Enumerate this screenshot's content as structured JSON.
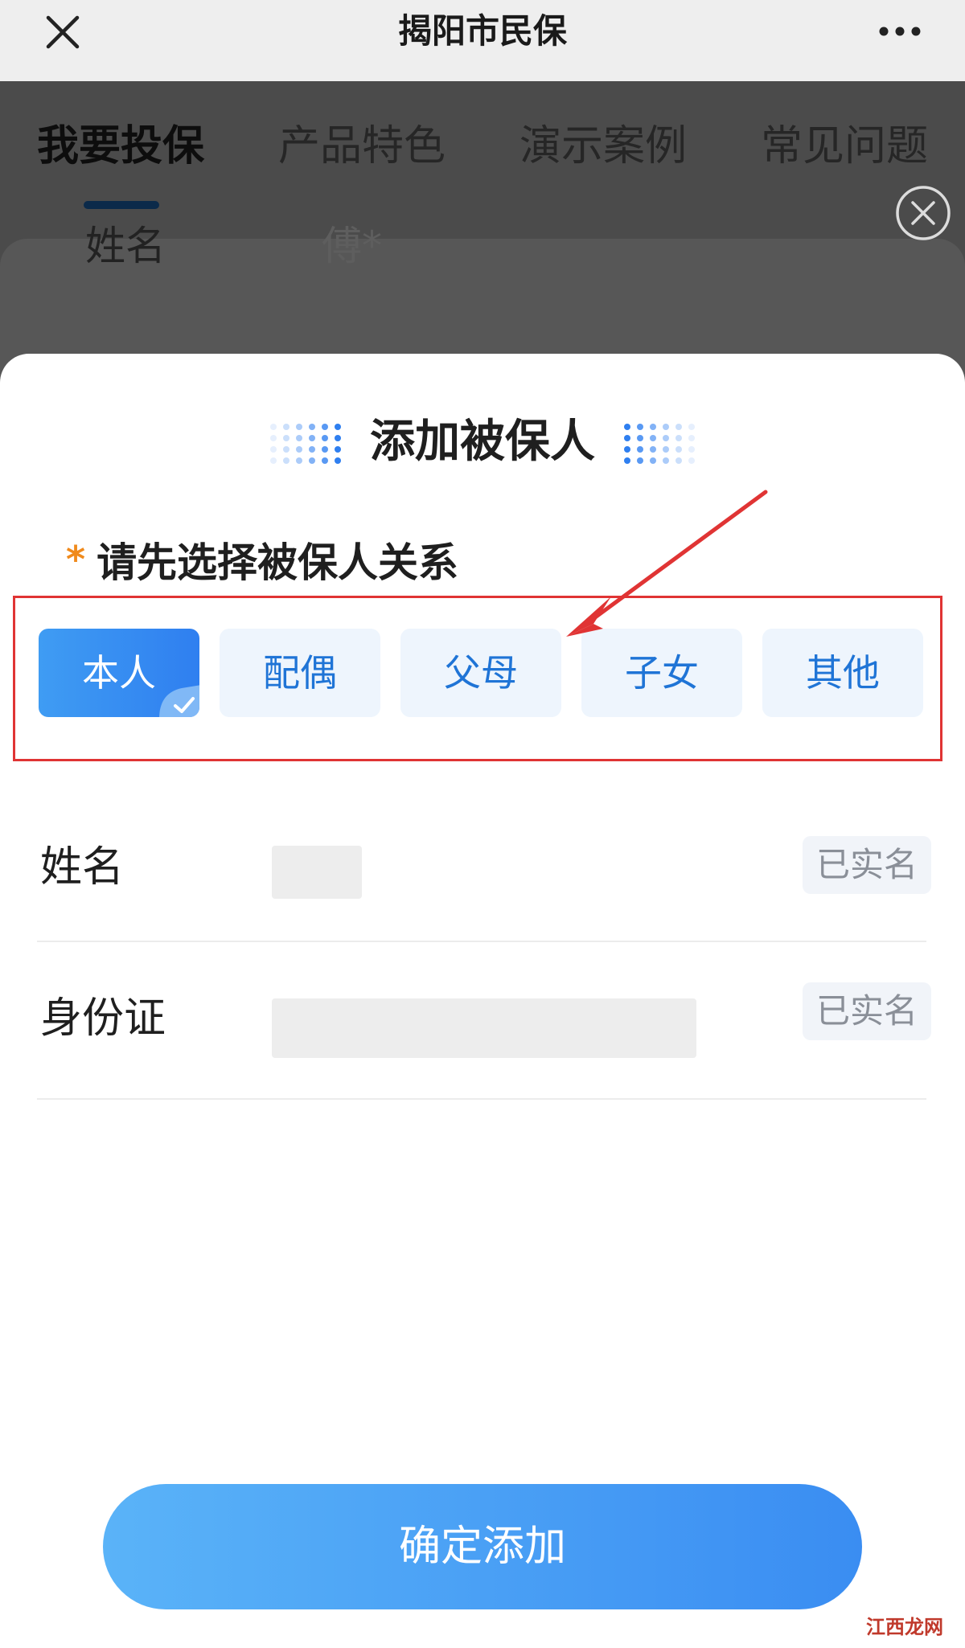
{
  "topbar": {
    "title": "揭阳市民保",
    "close_icon": "close-icon",
    "more_icon": "more-horizontal-icon"
  },
  "background": {
    "tabs": [
      "我要投保",
      "产品特色",
      "演示案例",
      "常见问题"
    ],
    "active_tab": "我要投保",
    "name_label": "姓名",
    "name_value": "傅*",
    "close_icon": "circle-close-icon"
  },
  "sheet": {
    "title": "添加被保人",
    "relation_required_mark": "*",
    "relation_heading": "请先选择被保人关系",
    "relations": [
      "本人",
      "配偶",
      "父母",
      "子女",
      "其他"
    ],
    "selected_relation": "本人",
    "fields": [
      {
        "label": "姓名",
        "badge": "已实名"
      },
      {
        "label": "身份证",
        "badge": "已实名"
      }
    ],
    "confirm_label": "确定添加"
  },
  "watermark": {
    "text": "江西龙网"
  },
  "colors": {
    "primary": "#2f7ff0",
    "chip_background": "#eef5fd",
    "required_mark": "#f08a1c",
    "annotation": "#e03434",
    "badge_text": "#8a8f98"
  }
}
